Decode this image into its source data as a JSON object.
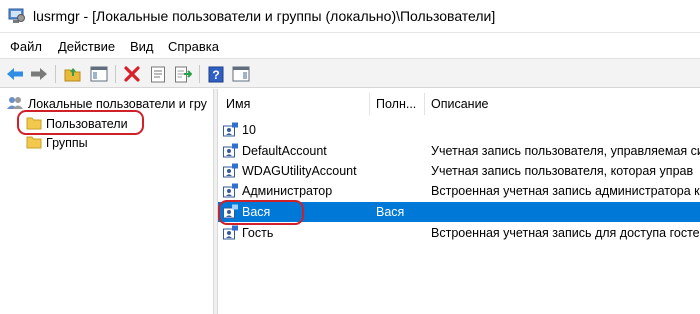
{
  "window": {
    "title": "lusrmgr - [Локальные пользователи и группы (локально)\\Пользователи]",
    "app_icon": "computer-management-icon"
  },
  "menu": {
    "items": [
      "Файл",
      "Действие",
      "Вид",
      "Справка"
    ]
  },
  "toolbar": {
    "buttons": [
      "back-arrow-icon",
      "forward-arrow-icon",
      "up-folder-icon",
      "show-hide-tree-icon",
      "delete-icon",
      "properties-icon",
      "export-list-icon",
      "help-icon",
      "action-pane-icon"
    ]
  },
  "tree": {
    "root_label": "Локальные пользователи и гру",
    "items": [
      {
        "label": "Пользователи",
        "selected": true
      },
      {
        "label": "Группы",
        "selected": false
      }
    ]
  },
  "list": {
    "columns": {
      "name": "Имя",
      "full_name": "Полн...",
      "description": "Описание"
    },
    "rows": [
      {
        "name": "10",
        "full_name": "",
        "description": ""
      },
      {
        "name": "DefaultAccount",
        "full_name": "",
        "description": "Учетная запись пользователя, управляемая си"
      },
      {
        "name": "WDAGUtilityAccount",
        "full_name": "",
        "description": "Учетная запись пользователя, которая управ"
      },
      {
        "name": "Администратор",
        "full_name": "",
        "description": "Встроенная учетная запись администратора к"
      },
      {
        "name": "Вася",
        "full_name": "Вася",
        "description": "",
        "selected": true
      },
      {
        "name": "Гость",
        "full_name": "",
        "description": "Встроенная учетная запись для доступа гостей"
      }
    ]
  },
  "colors": {
    "selection": "#0078d7",
    "highlight_oval": "#d0202a",
    "folder": "#f2c94c"
  }
}
